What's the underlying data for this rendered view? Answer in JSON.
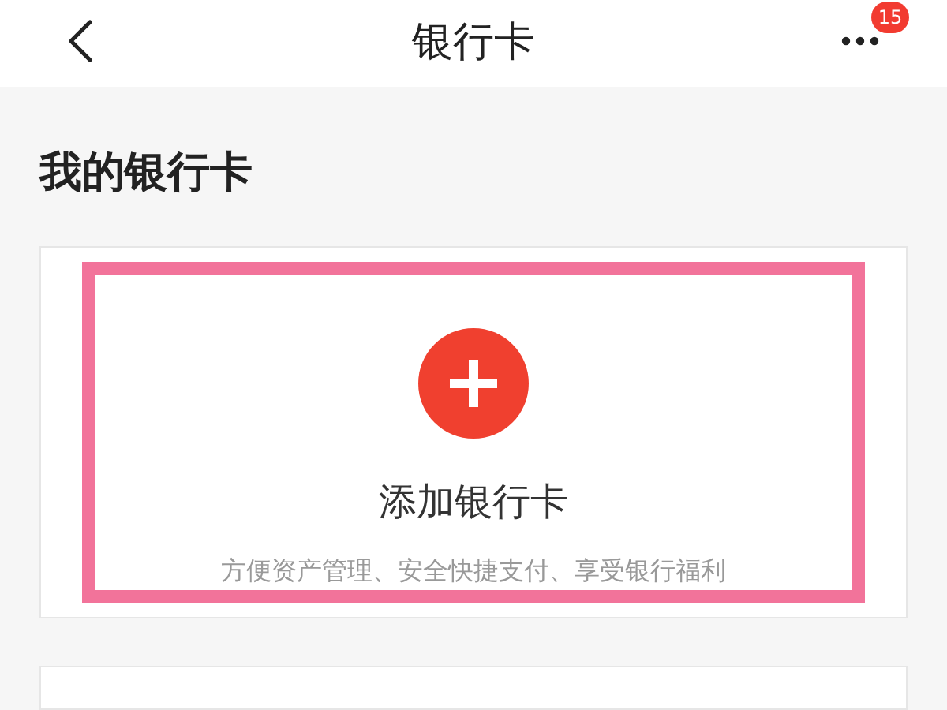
{
  "header": {
    "title": "银行卡",
    "badge": "15"
  },
  "section_title": "我的银行卡",
  "add_card": {
    "title": "添加银行卡",
    "subtitle": "方便资产管理、安全快捷支付、享受银行福利",
    "highlighted": true
  }
}
